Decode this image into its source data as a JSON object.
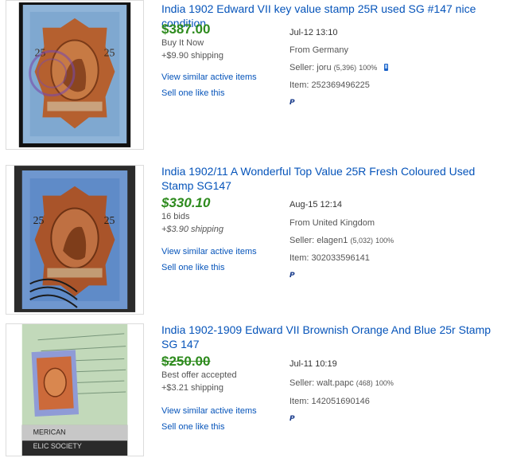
{
  "listings": [
    {
      "title": "India 1902 Edward VII key value stamp 25R used SG #147 nice condition",
      "price": "$387.00",
      "format": "Buy It Now",
      "shipping": "+$9.90 shipping",
      "similar": "View similar active items",
      "sell": "Sell one like this",
      "date": "Jul-12 13:10",
      "from": "From Germany",
      "seller_label": "Seller: ",
      "seller_name": "joru",
      "seller_count": "(5,396)",
      "seller_pct": "100%",
      "item": "Item: 252369496225",
      "image_alt": "Stamp photo 1",
      "payment_icon": "paypal-icon"
    },
    {
      "title": "India 1902/11 A Wonderful Top Value 25R Fresh Coloured Used Stamp SG147",
      "price": "$330.10",
      "format": "16 bids",
      "shipping": "+$3.90 shipping",
      "similar": "View similar active items",
      "sell": "Sell one like this",
      "date": "Aug-15 12:14",
      "from": "From United Kingdom",
      "seller_label": "Seller: ",
      "seller_name": "elagen1",
      "seller_count": "(5,032)",
      "seller_pct": "100%",
      "item": "Item: 302033596141",
      "payment_icon": "paypal-icon"
    },
    {
      "title": "India 1902-1909 Edward VII Brownish Orange And Blue 25r Stamp SG 147",
      "price": "$250.00",
      "format": "Best offer accepted",
      "shipping": "+$3.21 shipping",
      "similar": "View similar active items",
      "sell": "Sell one like this",
      "date": "Jul-11 10:19",
      "seller_label": "Seller: ",
      "seller_name": "walt.papc",
      "seller_count": "(468)",
      "seller_pct": "100%",
      "item": "Item: 142051690146",
      "payment_icon": "paypal-icon"
    }
  ],
  "colors": {
    "link": "#0654ba",
    "price": "#2e8b1e",
    "text": "#555555"
  }
}
